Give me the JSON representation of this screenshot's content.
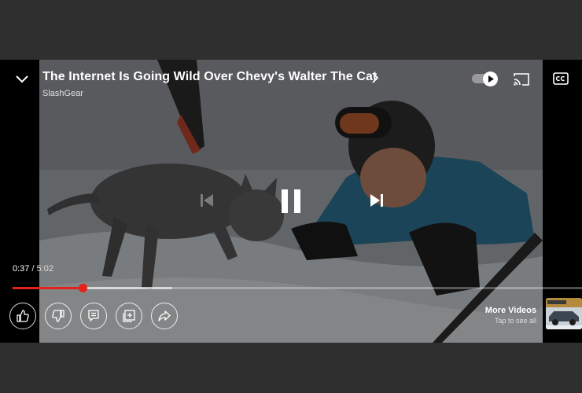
{
  "video": {
    "title": "The Internet Is Going Wild Over Chevy's Walter The Cat",
    "channel": "SlashGear",
    "current_time": "0:37",
    "time_separator": "/",
    "duration": "5:02",
    "played_fraction": 0.1225,
    "buffered_fraction": 0.28,
    "is_paused": false
  },
  "autoplay": {
    "enabled": true
  },
  "more_videos": {
    "title": "More Videos",
    "subtitle": "Tap to see all"
  },
  "colors": {
    "progress_red": "#e62117",
    "page_background": "#2f2f2f",
    "player_background": "#000000"
  },
  "icons": {
    "collapse": "chevron-down-icon",
    "title_expand": "chevron-right-icon",
    "cast": "cast-icon",
    "captions": "cc-icon",
    "previous": "skip-previous-icon",
    "pause": "pause-icon",
    "next": "skip-next-icon",
    "like": "thumbs-up-icon",
    "dislike": "thumbs-down-icon",
    "comments": "comment-icon",
    "save": "add-to-playlist-icon",
    "share": "share-icon"
  }
}
